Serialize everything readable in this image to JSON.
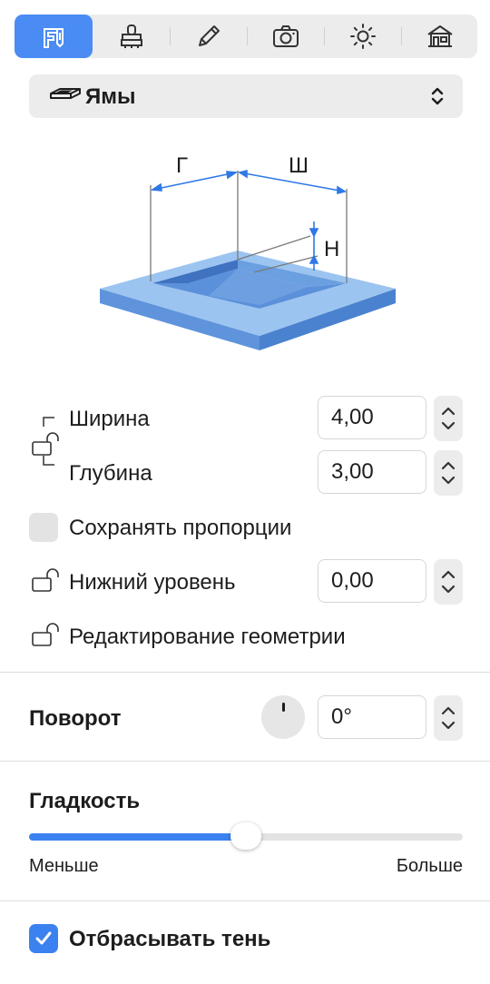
{
  "toolbar": {
    "tools": [
      {
        "icon": "caliper-icon",
        "active": true
      },
      {
        "icon": "stamp-icon",
        "active": false
      },
      {
        "icon": "pencil-icon",
        "active": false
      },
      {
        "icon": "camera-icon",
        "active": false
      },
      {
        "icon": "sun-icon",
        "active": false
      },
      {
        "icon": "house-icon",
        "active": false
      }
    ]
  },
  "object_type": {
    "label": "Ямы",
    "icon": "pit-icon"
  },
  "diagram": {
    "width_letter": "Ш",
    "depth_letter": "Г",
    "height_letter": "Н"
  },
  "fields": {
    "width": {
      "label": "Ширина",
      "value": "4,00"
    },
    "depth": {
      "label": "Глубина",
      "value": "3,00"
    },
    "keep_proportions": {
      "label": "Сохранять пропорции",
      "checked": false
    },
    "bottom_level": {
      "label": "Нижний уровень",
      "value": "0,00"
    },
    "edit_geometry": {
      "label": "Редактирование геометрии"
    }
  },
  "rotation": {
    "title": "Поворот",
    "value": "0°"
  },
  "smoothness": {
    "title": "Гладкость",
    "min_label": "Меньше",
    "max_label": "Больше",
    "level": 0.5
  },
  "shadow": {
    "label": "Отбрасывать тень",
    "checked": true
  },
  "colors": {
    "accent": "#3b82f0",
    "active_tool": "#4a8cf3"
  }
}
